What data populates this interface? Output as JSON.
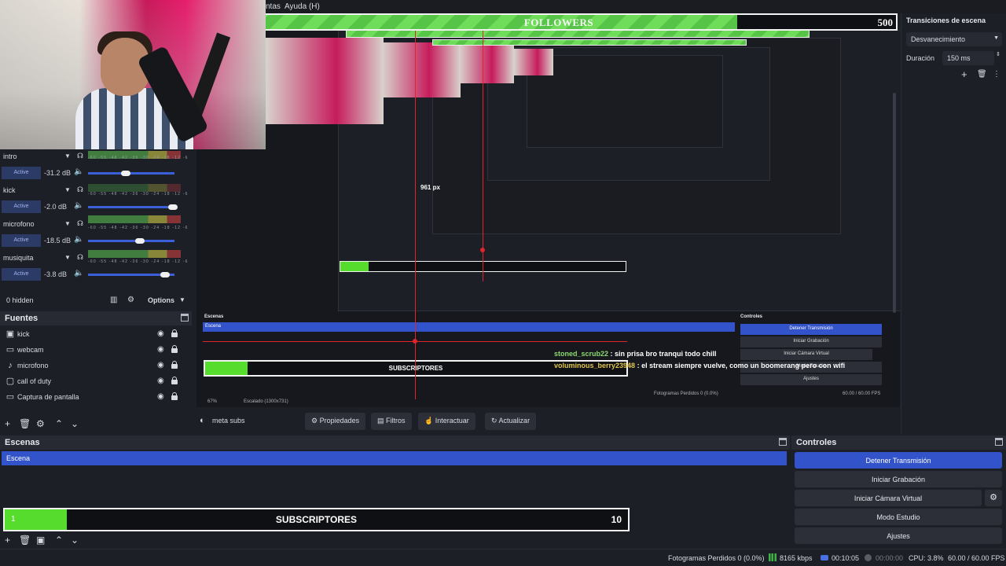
{
  "menu": {
    "items": [
      "ntas",
      "Ayuda (H)"
    ]
  },
  "followers_goal": {
    "label": "FOLLOWERS",
    "current": "382",
    "goal": "500",
    "progress": 0.764
  },
  "mixer": {
    "channels": [
      {
        "name": "intro",
        "state": "Active",
        "db": "-31.2 dB",
        "level": 0.45
      },
      {
        "name": "kick",
        "state": "Active",
        "db": "-2.0 dB",
        "level": 0.97
      },
      {
        "name": "microfono",
        "state": "Active",
        "db": "-18.5 dB",
        "level": 0.62
      },
      {
        "name": "musiquita",
        "state": "Active",
        "db": "-3.8 dB",
        "level": 0.9
      }
    ],
    "ticks": "-60 -55 -48 -42 -36 -30 -24 -18 -12 -6",
    "hidden_label": "0 hidden",
    "options_label": "Options"
  },
  "fuentes": {
    "title": "Fuentes",
    "items": [
      {
        "name": "kick",
        "icon": "audio-icon"
      },
      {
        "name": "webcam",
        "icon": "camera-icon"
      },
      {
        "name": "microfono",
        "icon": "mic-icon"
      },
      {
        "name": "call of duty",
        "icon": "game-icon"
      },
      {
        "name": "Captura de pantalla",
        "icon": "monitor-icon"
      }
    ]
  },
  "scene_ctx": {
    "scene_name": "meta subs",
    "buttons": [
      "Propiedades",
      "Filtros",
      "Interactuar",
      "Actualizar"
    ]
  },
  "transitions": {
    "title": "Transiciones de escena",
    "type": "Desvanecimiento",
    "duration_label": "Duración",
    "duration": "150 ms"
  },
  "escenas": {
    "title": "Escenas",
    "selected": "Escena"
  },
  "subs_goal": {
    "label": "SUBSCRIPTORES",
    "current": "1",
    "goal": "10",
    "progress": 0.1
  },
  "controles": {
    "title": "Controles",
    "buttons": [
      "Detener Transmisión",
      "Iniciar Grabación",
      "Iniciar Cámara Virtual",
      "Modo Estudio",
      "Ajustes"
    ]
  },
  "status": {
    "dropped": "Fotogramas Perdidos 0 (0.0%)",
    "bitrate": "8165 kbps",
    "stream_time": "00:10:05",
    "rec_time": "00:00:00",
    "cpu": "CPU: 3.8%",
    "fps": "60.00 / 60.00 FPS"
  },
  "preview": {
    "size_label": "961 px",
    "zoom": "67%",
    "scaled": "Escalado (1300x731)",
    "escenas_title": "Escenas",
    "controles_title": "Controles"
  },
  "chat": [
    {
      "user": "stoned_scrub22",
      "msg": ": sin prisa bro tranqui todo chill"
    },
    {
      "user": "voluminous_berry23948",
      "msg": ": el stream siempre vuelve, como un boomerang pero con wifi"
    }
  ],
  "colors": {
    "accent": "#3253c9",
    "goal_green": "#56dc2c",
    "red_guide": "#e0242b"
  }
}
